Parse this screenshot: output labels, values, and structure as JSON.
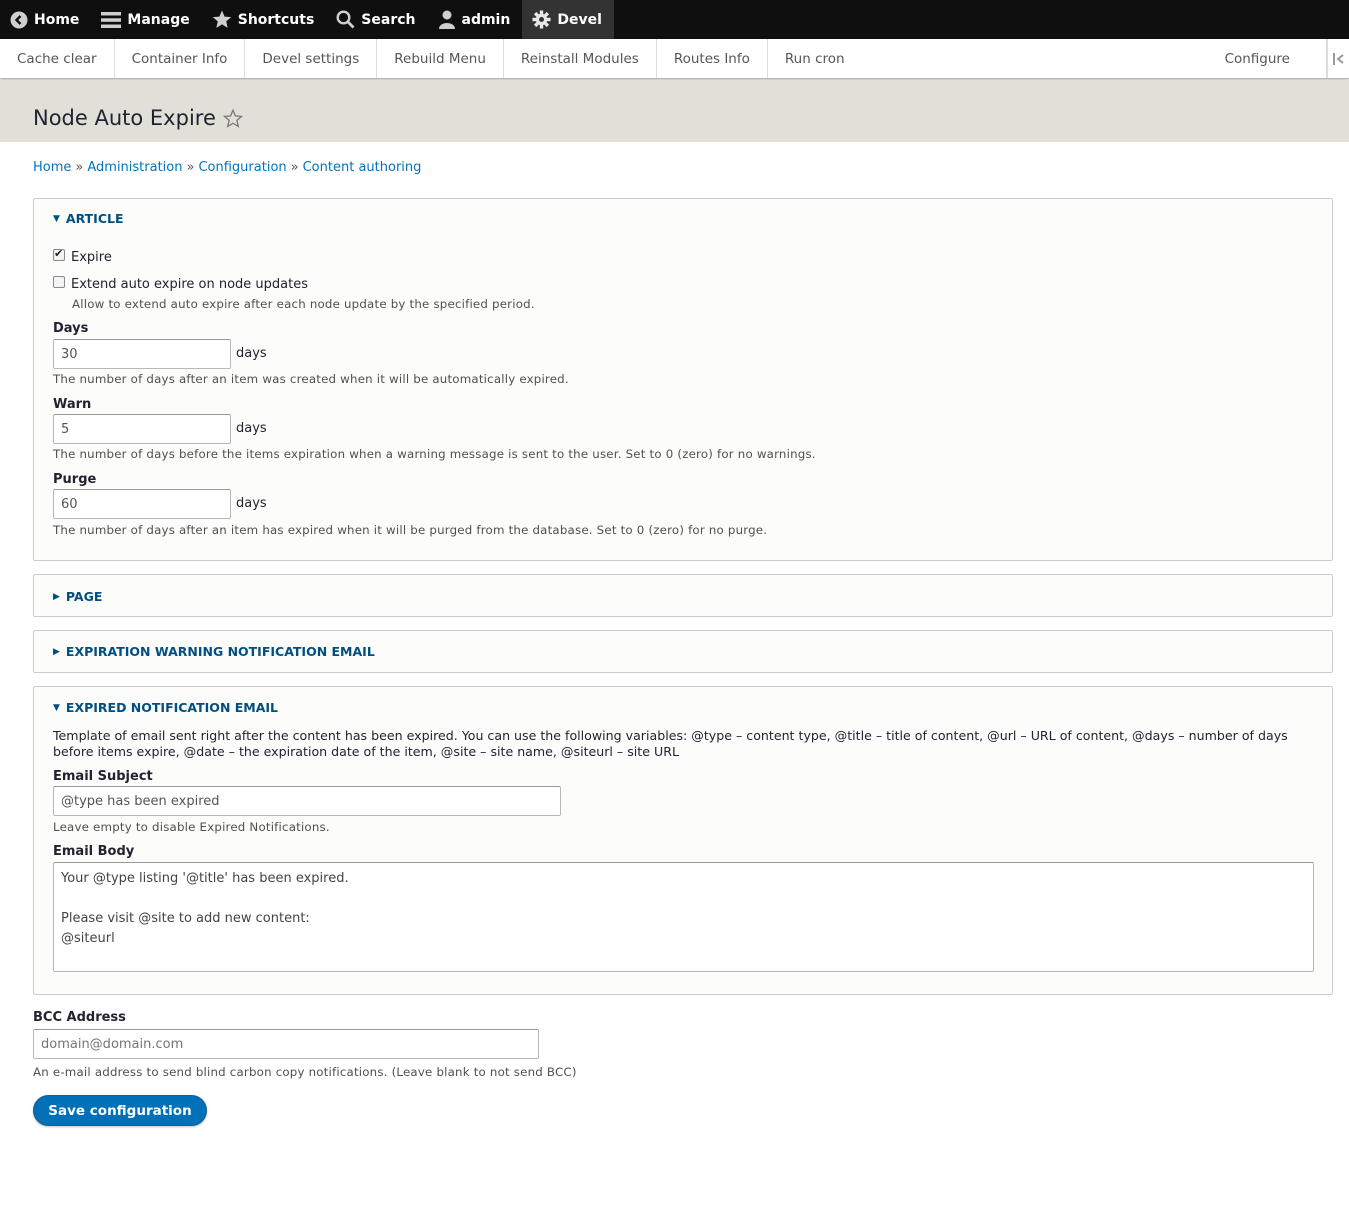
{
  "toolbar": {
    "home": "Home",
    "manage": "Manage",
    "shortcuts": "Shortcuts",
    "search": "Search",
    "user": "admin",
    "devel": "Devel"
  },
  "tray": {
    "items": [
      "Cache clear",
      "Container Info",
      "Devel settings",
      "Rebuild Menu",
      "Reinstall Modules",
      "Routes Info",
      "Run cron"
    ],
    "configure": "Configure"
  },
  "page": {
    "title": "Node Auto Expire"
  },
  "breadcrumb": [
    "Home",
    "Administration",
    "Configuration",
    "Content authoring"
  ],
  "breadcrumb_separator": "»",
  "article": {
    "summary": "ARTICLE",
    "expire_label": "Expire",
    "expire_checked": true,
    "extend_label": "Extend auto expire on node updates",
    "extend_checked": false,
    "extend_desc": "Allow to extend auto expire after each node update by the specified period.",
    "days_label": "Days",
    "days_value": "30",
    "days_suffix": "days",
    "days_desc": "The number of days after an item was created when it will be automatically expired.",
    "warn_label": "Warn",
    "warn_value": "5",
    "warn_suffix": "days",
    "warn_desc": "The number of days before the items expiration when a warning message is sent to the user. Set to 0 (zero) for no warnings.",
    "purge_label": "Purge",
    "purge_value": "60",
    "purge_suffix": "days",
    "purge_desc": "The number of days after an item has expired when it will be purged from the database. Set to 0 (zero) for no purge."
  },
  "page_section": {
    "summary": "PAGE"
  },
  "warning_email": {
    "summary": "EXPIRATION WARNING NOTIFICATION EMAIL"
  },
  "expired_email": {
    "summary": "EXPIRED NOTIFICATION EMAIL",
    "intro_line1": "Template of email sent right after the content has been expired. You can use the following variables: @type – content type, @title – title of content, @url – URL of content, @days – number of days",
    "intro_line2": "before items expire, @date – the expiration date of the item, @site – site name, @siteurl – site URL",
    "subject_label": "Email Subject",
    "subject_value": "@type has been expired",
    "subject_desc": "Leave empty to disable Expired Notifications.",
    "body_label": "Email Body",
    "body_value": "Your @type listing '@title' has been expired.\n\nPlease visit @site to add new content:\n@siteurl"
  },
  "bcc": {
    "label": "BCC Address",
    "placeholder": "domain@domain.com",
    "desc": "An e-mail address to send blind carbon copy notifications. (Leave blank to not send BCC)"
  },
  "save_label": "Save configuration"
}
